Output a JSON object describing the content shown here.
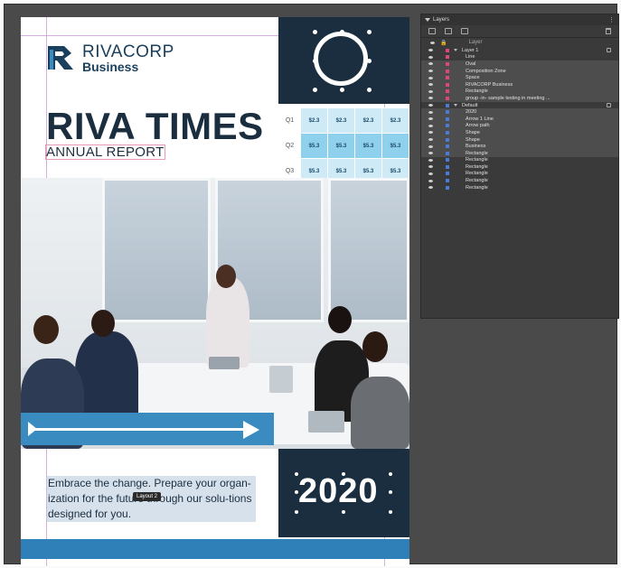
{
  "document": {
    "logo": {
      "name": "RIVACORP",
      "sub": "Business"
    },
    "title": "RIVA TIMES",
    "subtitle": "ANNUAL REPORT",
    "table": [
      {
        "q": "Q1",
        "values": [
          "$2.3",
          "$2.3",
          "$2.3",
          "$2.3"
        ]
      },
      {
        "q": "Q2",
        "values": [
          "$5.3",
          "$5.3",
          "$5.3",
          "$5.3"
        ]
      },
      {
        "q": "Q3",
        "values": [
          "$5.3",
          "$5.3",
          "$5.3",
          "$5.3"
        ]
      }
    ],
    "tagline": "Embrace the change. Prepare your organ-ization for the future through our solu-tions designed for you.",
    "selection_tag": "Layout 2",
    "year": "2020",
    "colors": {
      "navy": "#1b2e3f",
      "accent_blue": "#2f7fb8",
      "light_blue": "#cfeaf7"
    }
  },
  "layers_panel": {
    "title": "Layers",
    "search_placeholder": "Layer",
    "groups": [
      {
        "label": "Layer 1",
        "color": "#e0457b",
        "items": [
          "Line",
          "Oval",
          "Composition Zone",
          "Space",
          "RIVACORP Business",
          "Rectangle",
          "group -in- sample testing in meeting ..."
        ]
      },
      {
        "label": "Default",
        "color": "#4a7bd8",
        "items": [
          "2020",
          "Arrow 1 Line",
          "Arrow path",
          "Shape",
          "Shape",
          "Business",
          "Rectangle",
          "Rectangle",
          "Rectangle",
          "Rectangle",
          "Rectangle",
          "Rectangle"
        ]
      }
    ]
  }
}
